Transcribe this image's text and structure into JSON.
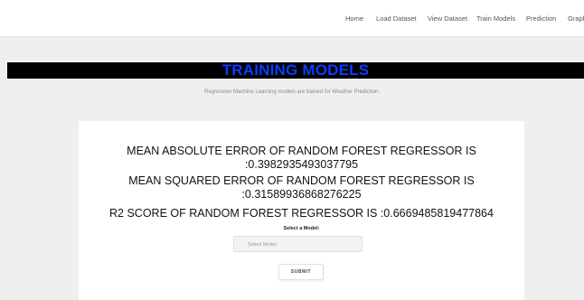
{
  "nav": {
    "items": [
      {
        "label": "Home"
      },
      {
        "label": "Load Dataset"
      },
      {
        "label": "View Dataset"
      },
      {
        "label": "Train Models"
      },
      {
        "label": "Prediction"
      },
      {
        "label": "Graph"
      }
    ]
  },
  "banner": {
    "title": "TRAINING MODELS",
    "title_color": "#0b3dff",
    "background": "#000000"
  },
  "subtitle": "Regression Machine Learning models are trained for Weather Prediction.",
  "results": {
    "mae_line1": "MEAN ABSOLUTE ERROR OF RANDOM FOREST REGRESSOR IS",
    "mae_line2": ":0.3982935493037795",
    "mse_line1": "MEAN SQUARED ERROR OF RANDOM FOREST REGRESSOR IS",
    "mse_line2": ":0.31589936868276225",
    "r2_line": "R2 SCORE OF RANDOM FOREST REGRESSOR IS :0.6669485819477864"
  },
  "form": {
    "select_label": "Select a Model:",
    "select_value": "Select Model",
    "submit_label": "SUBMIT"
  }
}
